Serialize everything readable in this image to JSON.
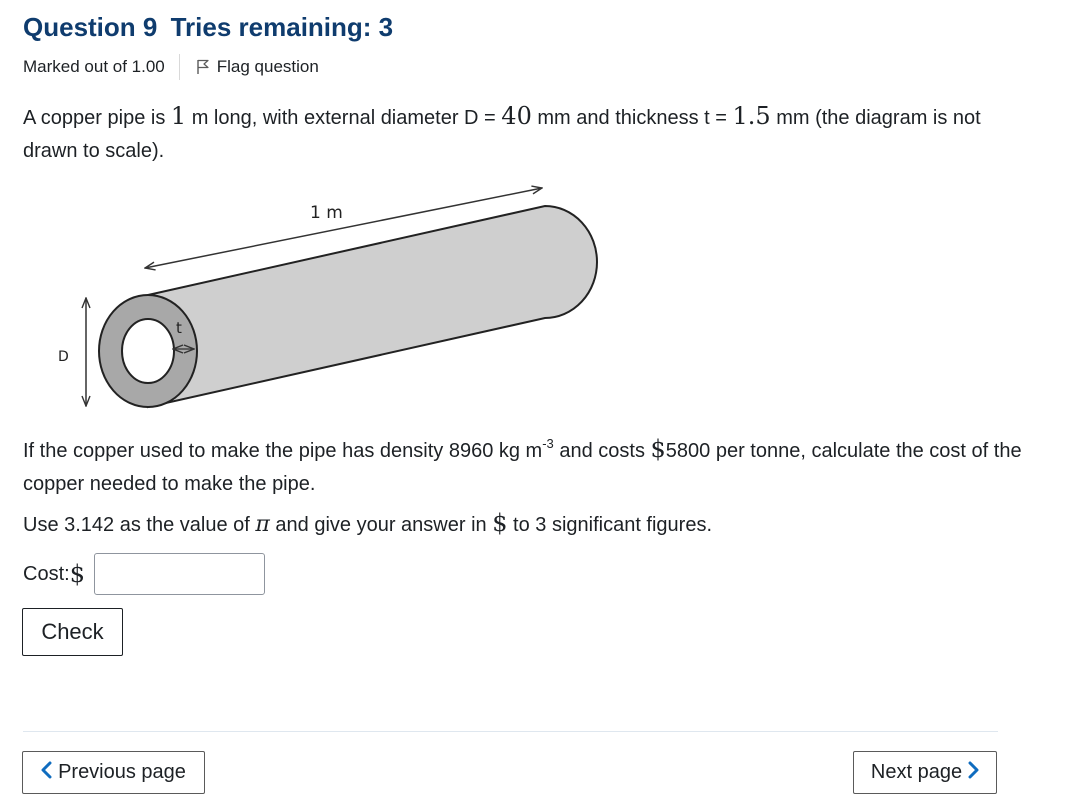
{
  "header": {
    "question_word": "Question",
    "question_number": "9",
    "tries_text": "Tries remaining: 3"
  },
  "meta": {
    "marked_out_of": "Marked out of 1.00",
    "flag_label": "Flag question"
  },
  "question": {
    "p1_a": "A copper pipe is ",
    "length_value": "1",
    "p1_b": " m long, with external diameter D = ",
    "diameter_value": "40",
    "p1_c": " mm and thickness t = ",
    "thickness_value": "1.5",
    "p1_d": " mm (the diagram is not drawn to scale).",
    "p2_a": "If the copper used to make the pipe has density 8960 kg m",
    "p2_exp": "-3",
    "p2_b": " and costs ",
    "cost_currency": "$",
    "p2_c": "5800 per tonne, calculate the cost of the copper needed to make the pipe.",
    "p3_a": "Use 3.142 as the value of ",
    "pi_symbol": "π",
    "p3_b": " and give your answer in ",
    "p3_currency": "$",
    "p3_c": " to 3 significant figures."
  },
  "diagram": {
    "length_label": "1 m",
    "diameter_label": "D",
    "thickness_label": "t"
  },
  "answer": {
    "label": "Cost: ",
    "currency": "$",
    "value": ""
  },
  "buttons": {
    "check": "Check",
    "previous": "Previous page",
    "next": "Next page"
  }
}
